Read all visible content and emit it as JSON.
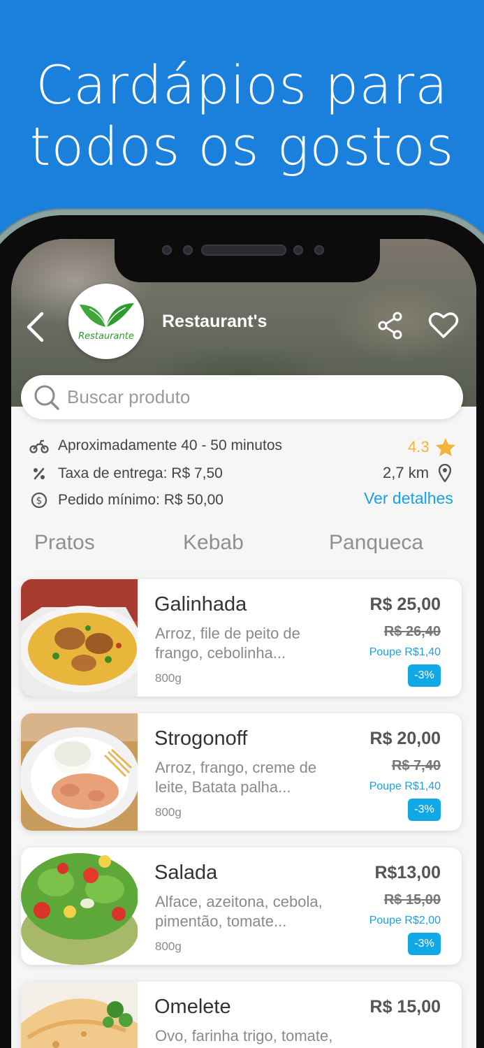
{
  "promo": {
    "line1": "Cardápios para",
    "line2": "todos os gostos"
  },
  "header": {
    "restaurant_name": "Restaurant's",
    "logo_text": "Restaurante"
  },
  "search": {
    "placeholder": "Buscar produto"
  },
  "info": {
    "delivery_time": "Aproximadamente 40 - 50 minutos",
    "delivery_fee": "Taxa de entrega: R$ 7,50",
    "min_order": "Pedido mínimo: R$ 50,00",
    "rating": "4.3",
    "distance": "2,7 km",
    "details_link": "Ver detalhes"
  },
  "tabs": [
    "Pratos",
    "Kebab",
    "Panqueca"
  ],
  "products": [
    {
      "name": "Galinhada",
      "desc1": "Arroz, file de peito de",
      "desc2": "frango, cebolinha...",
      "weight": "800g",
      "price": "R$ 25,00",
      "old_price": "R$ 26,40",
      "save": "Poupe R$1,40",
      "discount": "-3%"
    },
    {
      "name": "Strogonoff",
      "desc1": "Arroz, frango, creme de",
      "desc2": "leite, Batata palha...",
      "weight": "800g",
      "price": "R$ 20,00",
      "old_price": "R$ 7,40",
      "save": "Poupe R$1,40",
      "discount": "-3%"
    },
    {
      "name": "Salada",
      "desc1": "Alface, azeitona, cebola,",
      "desc2": "pimentão, tomate...",
      "weight": "800g",
      "price": "R$13,00",
      "old_price": "R$ 15,00",
      "save": "Poupe R$2,00",
      "discount": "-3%"
    },
    {
      "name": "Omelete",
      "desc1": "Ovo, farinha trigo, tomate,",
      "desc2": "",
      "weight": "",
      "price": "R$ 15,00",
      "old_price": "",
      "save": "",
      "discount": ""
    }
  ],
  "colors": {
    "background": "#1b7fdc",
    "accent": "#1aa0e6",
    "rating": "#f3b43c",
    "badge": "#12a8e6"
  }
}
